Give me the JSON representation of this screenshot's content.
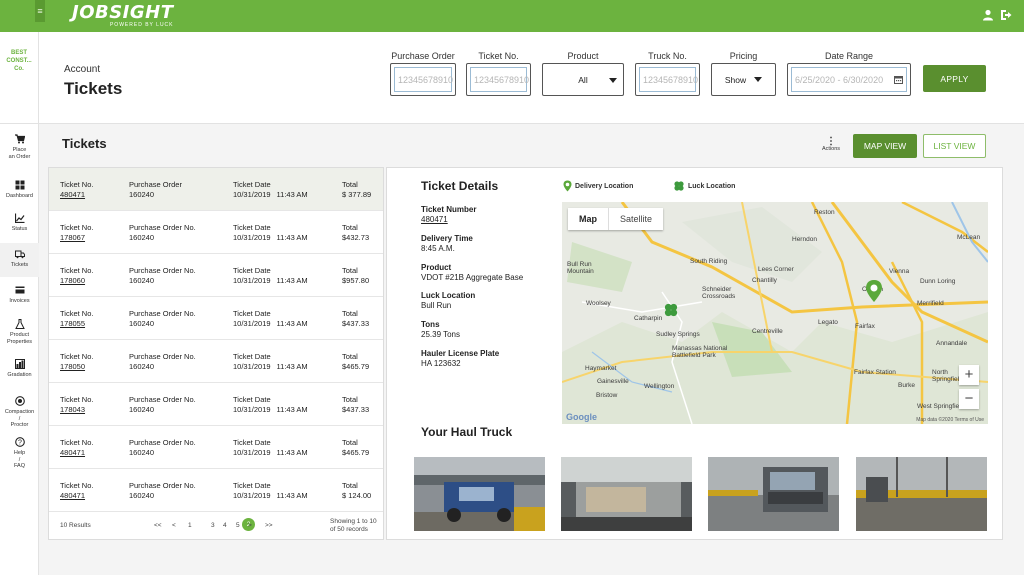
{
  "app": {
    "logo": "JOBSIGHT",
    "logo_sub": "POWERED BY LUCK",
    "menu_glyph": "≡",
    "user_icon": "user-icon",
    "logout_icon": "logout-icon",
    "brand_color": "#6cb33f"
  },
  "sidebar": {
    "company_line1": "BEST",
    "company_line2": "CONST...",
    "company_line3": "Co.",
    "items": [
      {
        "label_1": "Place",
        "label_2": "an Order",
        "label_3": "",
        "icon": "cart-icon"
      },
      {
        "label_1": "Dashboard",
        "label_2": "",
        "label_3": "",
        "icon": "dashboard-icon"
      },
      {
        "label_1": "Status",
        "label_2": "",
        "label_3": "",
        "icon": "status-chart-icon"
      },
      {
        "label_1": "Tickets",
        "label_2": "",
        "label_3": "",
        "icon": "truck-icon"
      },
      {
        "label_1": "Invoices",
        "label_2": "",
        "label_3": "",
        "icon": "credit-card-icon"
      },
      {
        "label_1": "Product",
        "label_2": "Properties",
        "label_3": "",
        "icon": "flask-icon"
      },
      {
        "label_1": "Gradation",
        "label_2": "",
        "label_3": "",
        "icon": "gradation-icon"
      },
      {
        "label_1": "Compaction",
        "label_2": "/",
        "label_3": "Proctor",
        "icon": "compaction-icon"
      },
      {
        "label_1": "Help",
        "label_2": "/",
        "label_3": "FAQ",
        "icon": "help-icon"
      }
    ]
  },
  "header": {
    "subtitle": "Account",
    "title": "Tickets",
    "filters": {
      "purchase_order": {
        "label": "Purchase Order",
        "placeholder": "12345678910"
      },
      "ticket_no": {
        "label": "Ticket No.",
        "placeholder": "12345678910"
      },
      "product": {
        "label": "Product",
        "value": "All"
      },
      "truck_no": {
        "label": "Truck No.",
        "placeholder": "12345678910"
      },
      "pricing": {
        "label": "Pricing",
        "value": "Show"
      },
      "date_range": {
        "label": "Date Range",
        "placeholder": "6/25/2020 - 6/30/2020"
      }
    },
    "apply_label": "APPLY"
  },
  "toolbar": {
    "section_title": "Tickets",
    "actions_label": "Actions",
    "map_view_label": "MAP VIEW",
    "list_view_label": "LIST VIEW"
  },
  "tickets": {
    "rows": [
      {
        "ticket_label": "Ticket No.",
        "ticket": "480471",
        "po_label": "Purchase Order",
        "po": "160240",
        "date_label": "Ticket Date",
        "date": "10/31/2019",
        "time": "11:43 AM",
        "total_label": "Total",
        "total": "$ 377.89"
      },
      {
        "ticket_label": "Ticket No.",
        "ticket": "178067",
        "po_label": "Purchase Order No.",
        "po": "160240",
        "date_label": "Ticket Date",
        "date": "10/31/2019",
        "time": "11:43 AM",
        "total_label": "Total",
        "total": "$432.73"
      },
      {
        "ticket_label": "Ticket No.",
        "ticket": "178060",
        "po_label": "Purchase Order No.",
        "po": "160240",
        "date_label": "Ticket Date",
        "date": "10/31/2019",
        "time": "11:43 AM",
        "total_label": "Total",
        "total": "$957.80"
      },
      {
        "ticket_label": "Ticket No.",
        "ticket": "178055",
        "po_label": "Purchase Order No.",
        "po": "160240",
        "date_label": "Ticket Date",
        "date": "10/31/2019",
        "time": "11:43 AM",
        "total_label": "Total",
        "total": "$437.33"
      },
      {
        "ticket_label": "Ticket No.",
        "ticket": "178050",
        "po_label": "Purchase Order No.",
        "po": "160240",
        "date_label": "Ticket Date",
        "date": "10/31/2019",
        "time": "11:43 AM",
        "total_label": "Total",
        "total": "$465.79"
      },
      {
        "ticket_label": "Ticket No.",
        "ticket": "178043",
        "po_label": "Purchase Order No.",
        "po": "160240",
        "date_label": "Ticket Date",
        "date": "10/31/2019",
        "time": "11:43 AM",
        "total_label": "Total",
        "total": "$437.33"
      },
      {
        "ticket_label": "Ticket No.",
        "ticket": "480471",
        "po_label": "Purchase Order No.",
        "po": "160240",
        "date_label": "Ticket Date",
        "date": "10/31/2019",
        "time": "11:43 AM",
        "total_label": "Total",
        "total": "$465.79"
      },
      {
        "ticket_label": "Ticket No.",
        "ticket": "480471",
        "po_label": "Purchase Order No.",
        "po": "160240",
        "date_label": "Ticket Date",
        "date": "10/31/2019",
        "time": "11:43 AM",
        "total_label": "Total",
        "total": "$ 124.00"
      }
    ],
    "pager": {
      "count": "10 Results",
      "first": "<<",
      "prev": "<",
      "pages": [
        "1",
        "2",
        "3",
        "4",
        "5"
      ],
      "active": "2",
      "next": ">",
      "last": ">>",
      "showing_1": "Showing 1 to 10",
      "showing_2": "of 50 records"
    }
  },
  "detail": {
    "title": "Ticket Details",
    "legend_delivery": "Delivery Location",
    "legend_luck": "Luck Location",
    "fields": [
      {
        "label": "Ticket Number",
        "value": "480471"
      },
      {
        "label": "Delivery Time",
        "value": "8:45 A.M."
      },
      {
        "label": "Product",
        "value": "VDOT #21B Aggregate Base"
      },
      {
        "label": "Luck Location",
        "value": "Bull Run"
      },
      {
        "label": "Tons",
        "value": "25.39 Tons"
      },
      {
        "label": "Hauler License Plate",
        "value": "HA 123632"
      }
    ],
    "map": {
      "toggle_map": "Map",
      "toggle_satellite": "Satellite",
      "zoom_in": "+",
      "zoom_out": "−",
      "google": "Google",
      "footer": "Map data ©2020    Terms of Use",
      "places": [
        "Reston",
        "Herndon",
        "McLean",
        "Bull Run",
        "Mountain",
        "South Riding",
        "Lees Corner",
        "Chantilly",
        "Vienna",
        "Dunn Loring",
        "Schneider Crossroads",
        "Woolsey",
        "Oakton",
        "Merrifield",
        "Catharpin",
        "Sudley Springs",
        "Legato",
        "Fairfax",
        "Centreville",
        "Manassas National Battlefield Park",
        "Annandale",
        "Haymarket",
        "Fairfax Station",
        "Gainesville",
        "Burke",
        "North Springfield",
        "Bristow",
        "West Springfield",
        "Wellington"
      ]
    },
    "haul_title": "Your Haul Truck"
  }
}
